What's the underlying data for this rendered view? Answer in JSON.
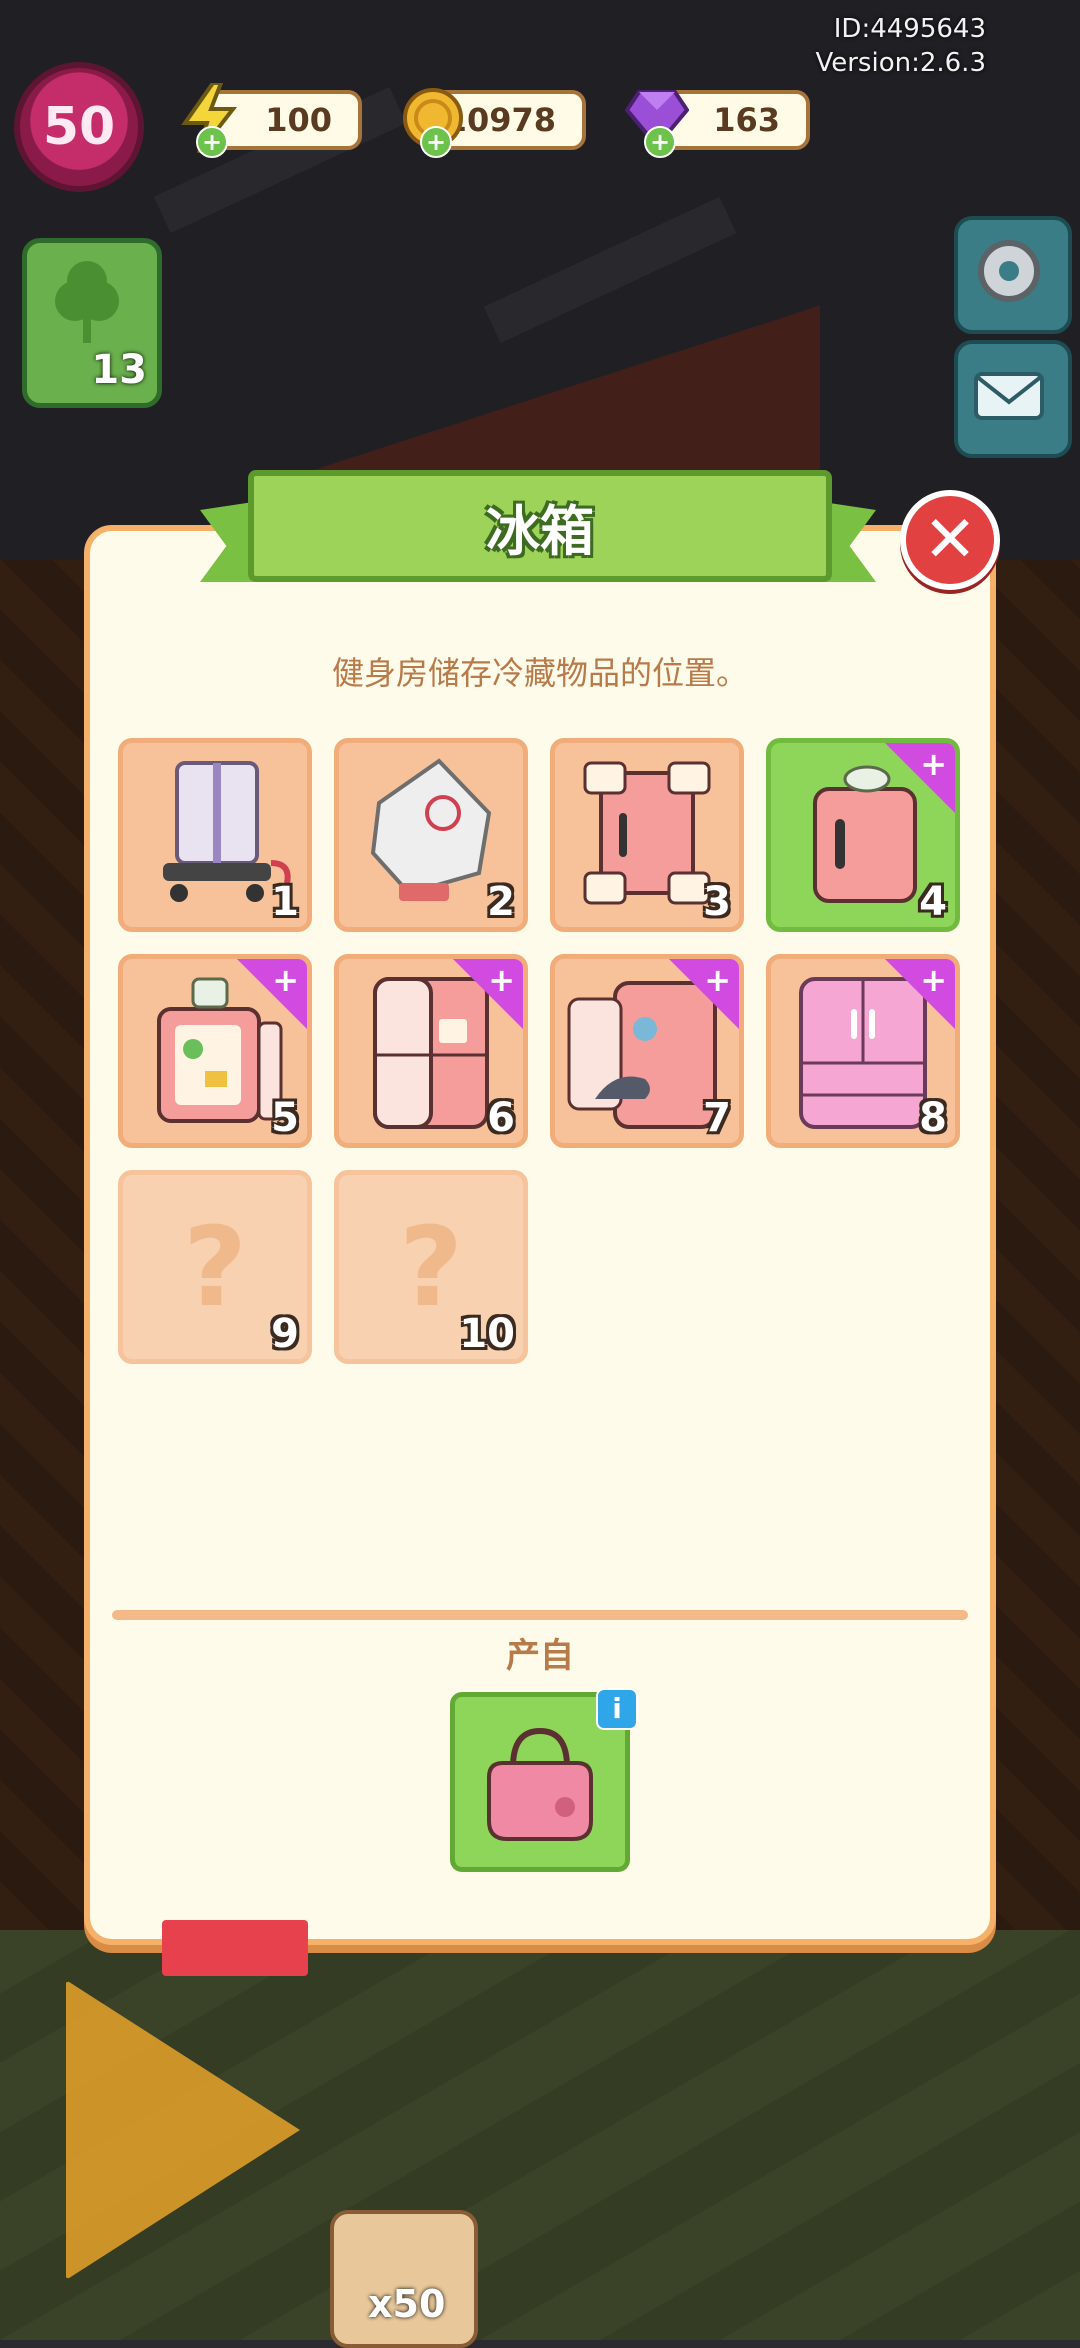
{
  "meta": {
    "id_label": "ID:4495643",
    "version_label": "Version:2.6.3"
  },
  "hud": {
    "level": "50",
    "energy": "100",
    "coins": "10978",
    "gems": "163",
    "energy_icon": "lightning-icon",
    "coin_icon": "coin-icon",
    "gem_icon": "gem-icon"
  },
  "side": {
    "left_card_count": "13",
    "bottom_pack_count": "x50"
  },
  "dialog": {
    "title": "冰箱",
    "description": "健身房储存冷藏物品的位置。",
    "source_label": "产自",
    "source_icon": "handbag-icon",
    "info_label": "i",
    "close_label": "✕"
  },
  "items": [
    {
      "num": "1",
      "state": "normal",
      "icon": "boxed-cart-icon"
    },
    {
      "num": "2",
      "state": "normal",
      "icon": "wrapped-package-icon"
    },
    {
      "num": "3",
      "state": "normal",
      "icon": "packed-fridge-icon"
    },
    {
      "num": "4",
      "state": "active",
      "icon": "small-fridge-icon",
      "plus": "+"
    },
    {
      "num": "5",
      "state": "normal",
      "icon": "open-fridge-icon",
      "plus": "+"
    },
    {
      "num": "6",
      "state": "normal",
      "icon": "double-fridge-icon",
      "plus": "+"
    },
    {
      "num": "7",
      "state": "normal",
      "icon": "fridge-with-cat-icon",
      "plus": "+"
    },
    {
      "num": "8",
      "state": "normal",
      "icon": "french-door-fridge-icon",
      "plus": "+"
    },
    {
      "num": "9",
      "state": "locked",
      "icon": "question-mark-icon",
      "placeholder": "?"
    },
    {
      "num": "10",
      "state": "locked",
      "icon": "question-mark-icon",
      "placeholder": "?"
    }
  ],
  "colors": {
    "panel": "#fffbea",
    "ribbon": "#9ed35a",
    "slot": "#f7c29a",
    "active": "#8ed65a",
    "plus": "#d24be0",
    "close": "#e24141"
  }
}
